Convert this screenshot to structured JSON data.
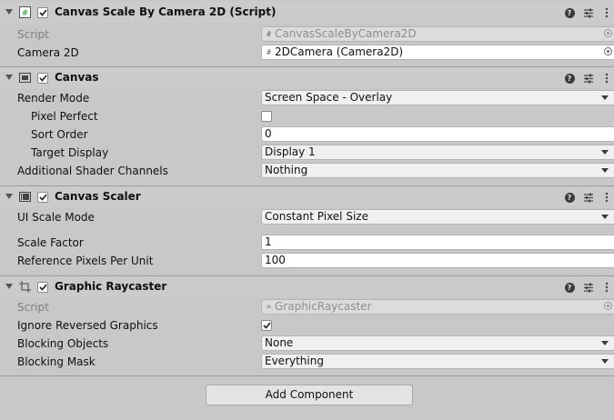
{
  "components": [
    {
      "title": "Canvas Scale By Camera 2D (Script)",
      "icon": "script-hash-icon",
      "enabled": true,
      "props": [
        {
          "label": "Script",
          "value": "CanvasScaleByCamera2D",
          "dim": true
        },
        {
          "label": "Camera 2D",
          "value": "2DCamera (Camera2D)"
        }
      ]
    },
    {
      "title": "Canvas",
      "icon": "canvas-icon",
      "enabled": true,
      "props": [
        {
          "label": "Render Mode",
          "value": "Screen Space - Overlay"
        },
        {
          "label": "Pixel Perfect",
          "checked": false
        },
        {
          "label": "Sort Order",
          "value": "0"
        },
        {
          "label": "Target Display",
          "value": "Display 1"
        },
        {
          "label": "Additional Shader Channels",
          "value": "Nothing"
        }
      ]
    },
    {
      "title": "Canvas Scaler",
      "icon": "canvas-scaler-icon",
      "enabled": true,
      "props": [
        {
          "label": "UI Scale Mode",
          "value": "Constant Pixel Size"
        },
        {
          "label": "Scale Factor",
          "value": "1"
        },
        {
          "label": "Reference Pixels Per Unit",
          "value": "100"
        }
      ]
    },
    {
      "title": "Graphic Raycaster",
      "icon": "graphic-raycaster-icon",
      "enabled": true,
      "props": [
        {
          "label": "Script",
          "value": "GraphicRaycaster",
          "dim": true
        },
        {
          "label": "Ignore Reversed Graphics",
          "checked": true
        },
        {
          "label": "Blocking Objects",
          "value": "None"
        },
        {
          "label": "Blocking Mask",
          "value": "Everything"
        }
      ]
    }
  ],
  "header_buttons": {
    "help": "?"
  },
  "add_component_label": "Add Component"
}
